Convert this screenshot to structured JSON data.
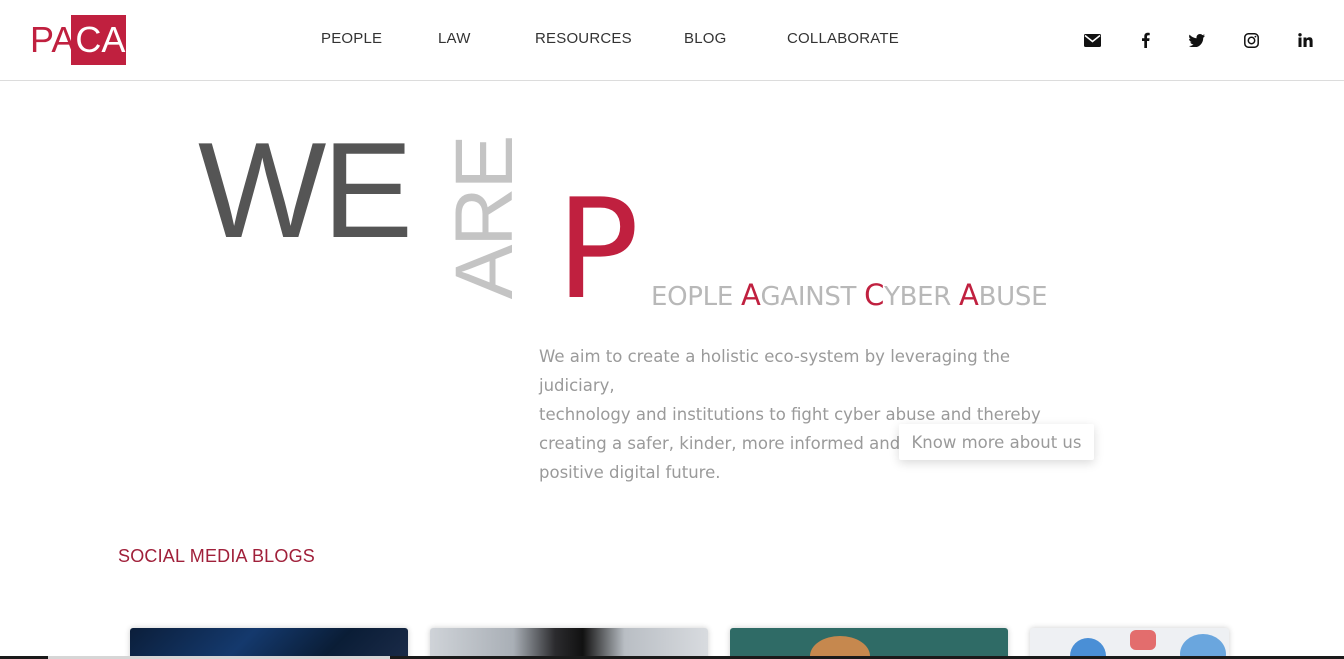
{
  "brand": {
    "logo_left": "PA",
    "logo_right": "CA"
  },
  "nav": {
    "items": [
      "PEOPLE",
      "LAW",
      "RESOURCES",
      "BLOG",
      "COLLABORATE"
    ]
  },
  "social": {
    "icons": [
      "envelope-icon",
      "facebook-icon",
      "twitter-icon",
      "instagram-icon",
      "linkedin-icon"
    ],
    "glyphs": [
      "✉",
      "f",
      "🐦",
      "◎",
      "in"
    ]
  },
  "hero": {
    "we": "WE",
    "are": "ARE",
    "p": "P",
    "tagline": {
      "w1_rest": "EOPLE ",
      "w2_cap": "A",
      "w2_rest": "GAINST ",
      "w3_cap": "C",
      "w3_rest": "YBER ",
      "w4_cap": "A",
      "w4_rest": "BUSE"
    },
    "description_lines": [
      "We aim to create a holistic eco-system by leveraging the judiciary,",
      "technology and institutions to fight cyber abuse and thereby",
      "creating a safer, kinder, more informed and",
      "positive digital future."
    ],
    "cta": "Know more about us"
  },
  "blogs": {
    "title": "SOCIAL MEDIA BLOGS"
  },
  "colors": {
    "accent": "#c0203f",
    "dark_text": "#555555",
    "light_text": "#b8b8b8"
  }
}
